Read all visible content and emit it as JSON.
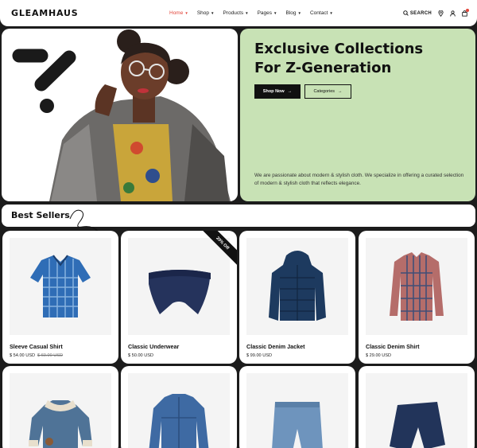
{
  "header": {
    "logo": "GLEAMHAUS",
    "nav": [
      {
        "label": "Home",
        "active": true
      },
      {
        "label": "Shop"
      },
      {
        "label": "Products"
      },
      {
        "label": "Pages"
      },
      {
        "label": "Blog"
      },
      {
        "label": "Contact"
      }
    ],
    "search_label": "SEARCH",
    "icons": [
      "search-icon",
      "location-pin-icon",
      "user-icon",
      "cart-icon"
    ]
  },
  "hero": {
    "title_line1": "Exclusive Collections",
    "title_line2": "For Z-Generation",
    "shop_button": "Shop Now",
    "categories_button": "Categories",
    "description": "We are passionate about modern & stylish cloth. We specialize in offering a curated selection of modern & stylish cloth that reflects elegance."
  },
  "best_sellers": {
    "title": "Best Sellers"
  },
  "products": [
    {
      "name": "Sleeve Casual Shirt",
      "price": "$ 54.00 USD",
      "old_price": "$ 60.00 USD",
      "image": "blue-plaid-shirt"
    },
    {
      "name": "Classic Underwear",
      "price": "$ 50.00 USD",
      "old_price": "",
      "badge": "20% Off",
      "image": "navy-briefs"
    },
    {
      "name": "Classic Denim Jacket",
      "price": "$ 99.00 USD",
      "old_price": "",
      "image": "navy-puffer-jacket"
    },
    {
      "name": "Classic Denim Shirt",
      "price": "$ 29.00 USD",
      "old_price": "",
      "image": "plaid-long-sleeve-shirt"
    },
    {
      "name": "",
      "price": "",
      "image": "sherpa-denim-jacket"
    },
    {
      "name": "",
      "price": "",
      "image": "denim-jacket"
    },
    {
      "name": "",
      "price": "",
      "image": "denim-shorts"
    },
    {
      "name": "",
      "price": "",
      "image": "navy-shorts"
    }
  ],
  "colors": {
    "accent": "#e2463b",
    "hero_green": "#c8e2b5",
    "background": "#1c1c1c",
    "card_image_bg": "#f4f4f4"
  }
}
